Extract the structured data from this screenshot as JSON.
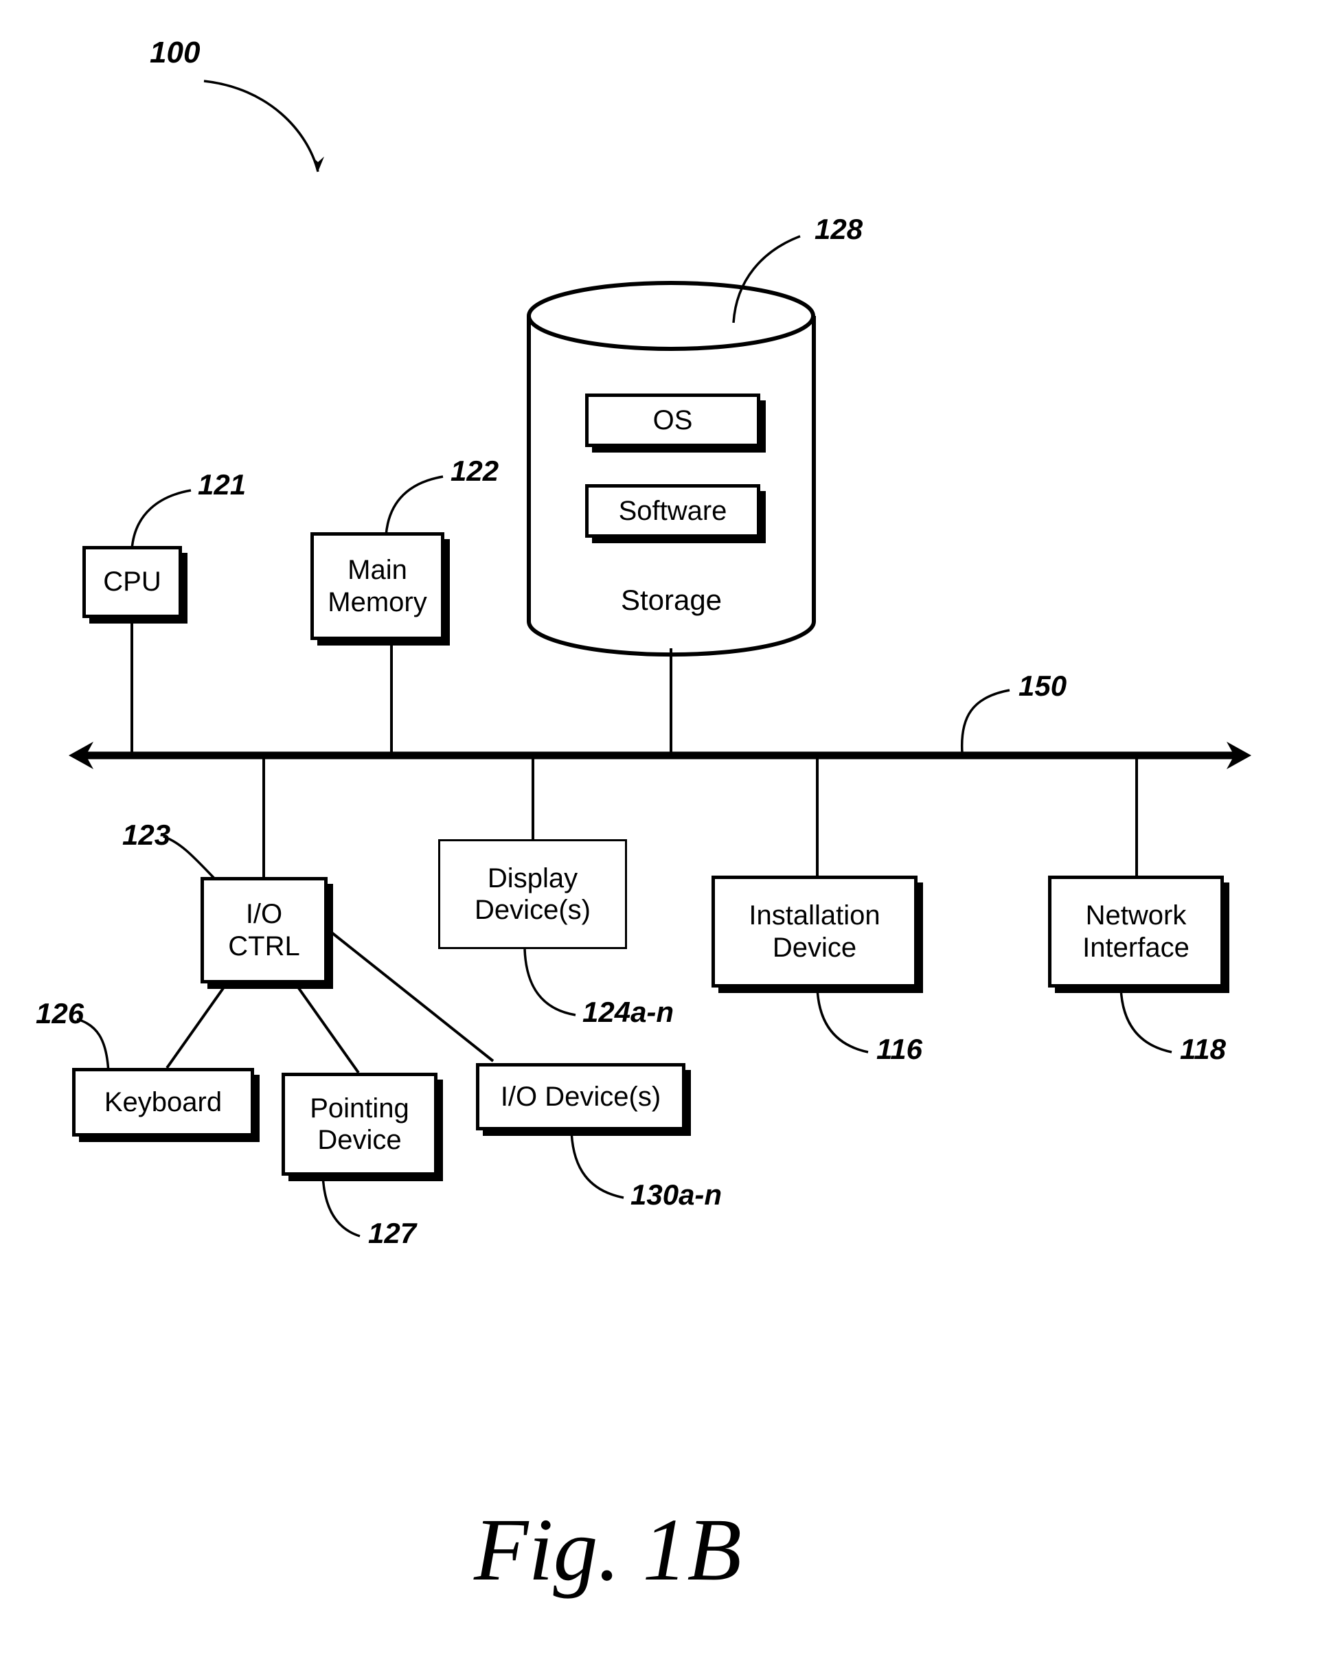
{
  "figure": {
    "caption": "Fig. 1B",
    "system_ref": "100"
  },
  "nodes": {
    "cpu": {
      "label": "CPU",
      "ref": "121"
    },
    "main_memory": {
      "label_line1": "Main",
      "label_line2": "Memory",
      "ref": "122"
    },
    "storage": {
      "label": "Storage",
      "ref": "128",
      "os_label": "OS",
      "software_label": "Software"
    },
    "bus": {
      "ref": "150"
    },
    "io_ctrl": {
      "label_line1": "I/O",
      "label_line2": "CTRL",
      "ref": "123"
    },
    "display": {
      "label_line1": "Display",
      "label_line2": "Device(s)",
      "ref": "124a-n"
    },
    "installation": {
      "label_line1": "Installation",
      "label_line2": "Device",
      "ref": "116"
    },
    "network": {
      "label_line1": "Network",
      "label_line2": "Interface",
      "ref": "118"
    },
    "keyboard": {
      "label": "Keyboard",
      "ref": "126"
    },
    "pointing": {
      "label_line1": "Pointing",
      "label_line2": "Device",
      "ref": "127"
    },
    "io_devices": {
      "label": "I/O Device(s)",
      "ref": "130a-n"
    }
  },
  "colors": {
    "ink": "#000000",
    "paper": "#ffffff"
  }
}
